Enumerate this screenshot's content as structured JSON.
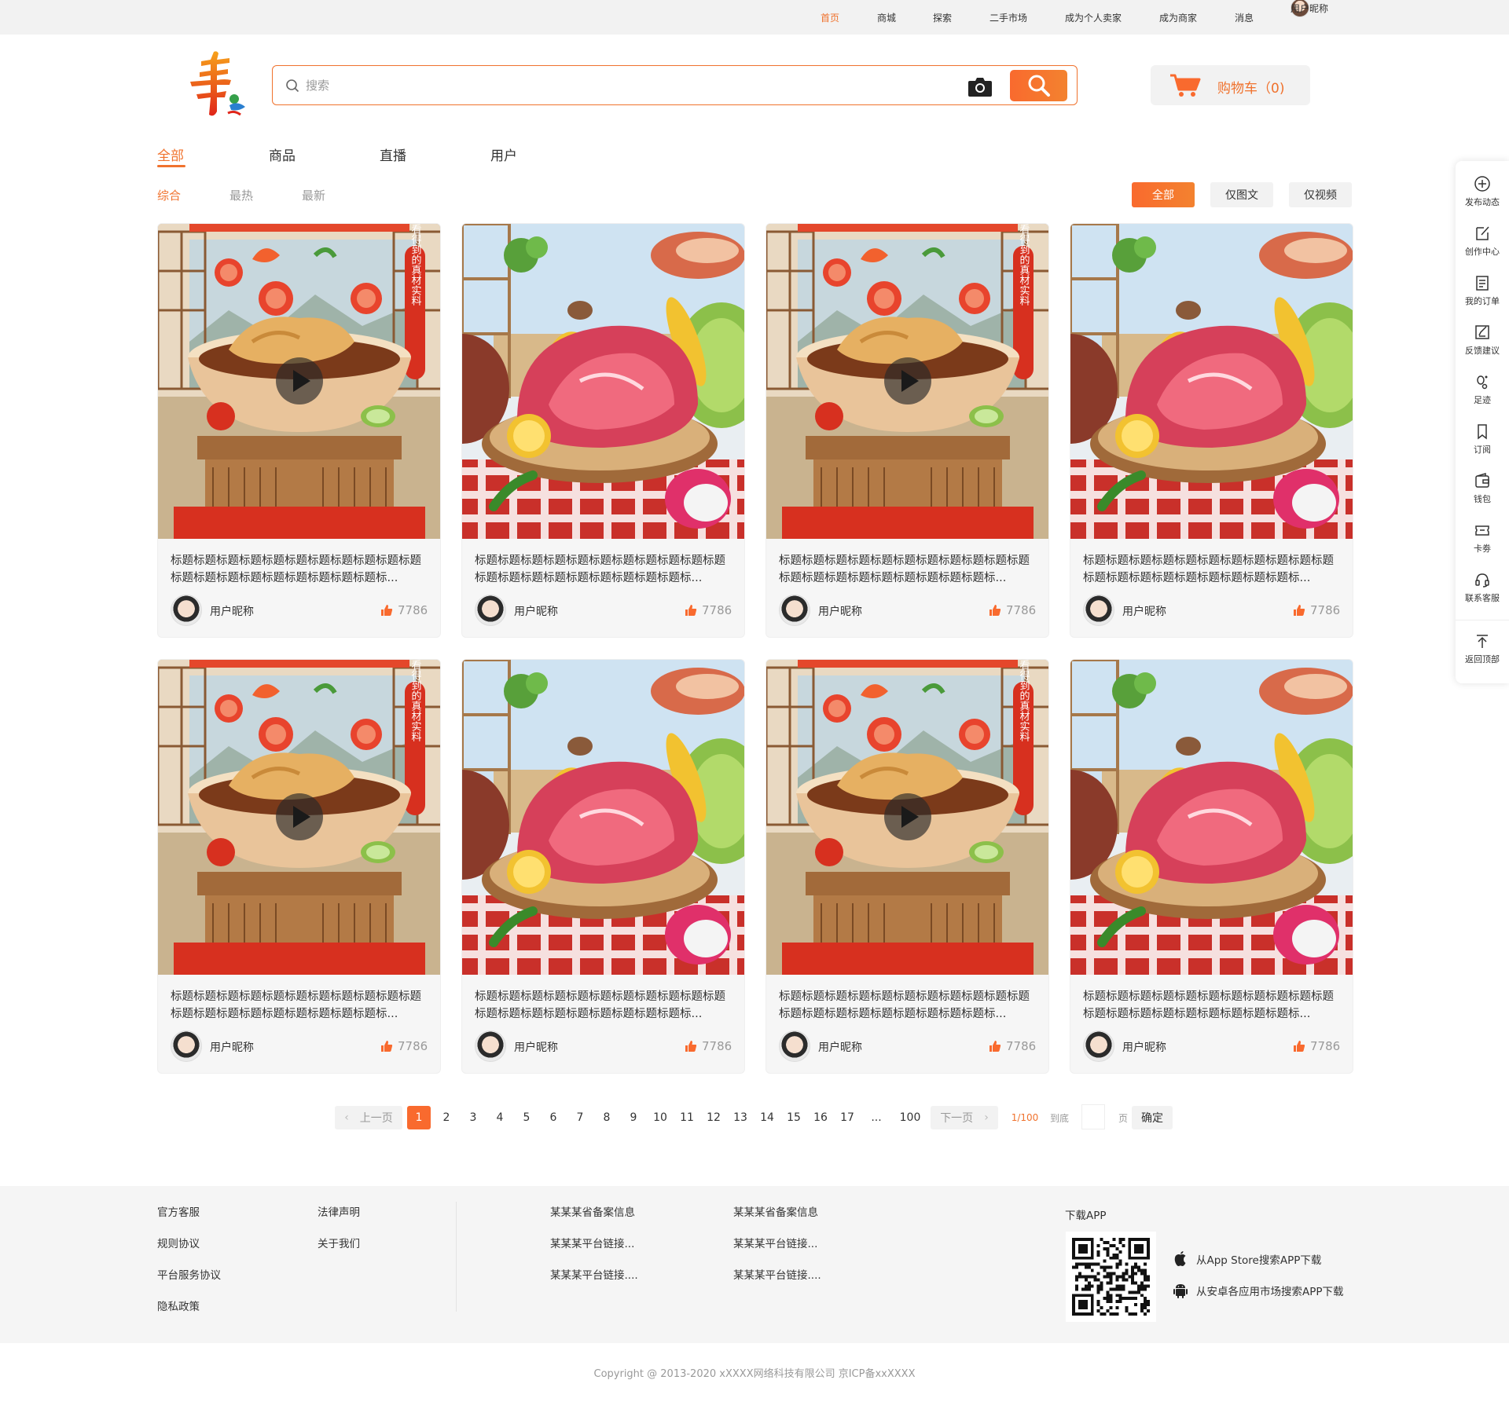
{
  "topnav": {
    "items": [
      "首页",
      "商城",
      "探索",
      "二手市场",
      "成为个人卖家",
      "成为商家",
      "消息"
    ],
    "user_name": "用户昵称"
  },
  "search": {
    "placeholder": "搜索"
  },
  "cart": {
    "label": "购物车（0)"
  },
  "main_tabs": [
    "全部",
    "商品",
    "直播",
    "用户"
  ],
  "sub_tabs": [
    "综合",
    "最热",
    "最新"
  ],
  "filters": [
    "全部",
    "仅图文",
    "仅视频"
  ],
  "cards": [
    {
      "title": "标题标题标题标题标题标题标题标题标题标题标题标题标题标题标题标题标题标题标题标题标...",
      "user": "用户昵称",
      "likes": "7786",
      "image": "video-soup-dish-icon"
    },
    {
      "title": "标题标题标题标题标题标题标题标题标题标题标题标题标题标题标题标题标题标题标题标题标...",
      "user": "用户昵称",
      "likes": "7786",
      "image": "raw-meat-icon"
    },
    {
      "title": "标题标题标题标题标题标题标题标题标题标题标题标题标题标题标题标题标题标题标题标题标...",
      "user": "用户昵称",
      "likes": "7786",
      "image": "video-soup-dish-icon"
    },
    {
      "title": "标题标题标题标题标题标题标题标题标题标题标题标题标题标题标题标题标题标题标题标题标...",
      "user": "用户昵称",
      "likes": "7786",
      "image": "raw-meat-icon"
    },
    {
      "title": "标题标题标题标题标题标题标题标题标题标题标题标题标题标题标题标题标题标题标题标题标...",
      "user": "用户昵称",
      "likes": "7786",
      "image": "video-soup-dish-icon"
    },
    {
      "title": "标题标题标题标题标题标题标题标题标题标题标题标题标题标题标题标题标题标题标题标题标...",
      "user": "用户昵称",
      "likes": "7786",
      "image": "raw-meat-icon"
    },
    {
      "title": "标题标题标题标题标题标题标题标题标题标题标题标题标题标题标题标题标题标题标题标题标...",
      "user": "用户昵称",
      "likes": "7786",
      "image": "video-soup-dish-icon"
    },
    {
      "title": "标题标题标题标题标题标题标题标题标题标题标题标题标题标题标题标题标题标题标题标题标...",
      "user": "用户昵称",
      "likes": "7786",
      "image": "raw-meat-icon"
    }
  ],
  "banner_text": "看得到的真材实料",
  "pagination": {
    "prev": "上一页",
    "pages": [
      "1",
      "2",
      "3",
      "4",
      "5",
      "6",
      "7",
      "8",
      "9",
      "10",
      "11",
      "12",
      "13",
      "14",
      "15",
      "16",
      "17"
    ],
    "ellipsis": "...",
    "last": "100",
    "next": "下一页",
    "current_label": "1/100",
    "goto_label": "到底",
    "page_unit": "页",
    "confirm": "确定"
  },
  "footer": {
    "col1": [
      "官方客服",
      "规则协议",
      "平台服务协议",
      "隐私政策"
    ],
    "col2": [
      "法律声明",
      "关于我们"
    ],
    "col3": [
      "某某某省备案信息",
      "某某某平台链接...",
      "某某某平台链接...."
    ],
    "col4": [
      "某某某省备案信息",
      "某某某平台链接...",
      "某某某平台链接...."
    ],
    "download_title": "下载APP",
    "app_store": "从App Store搜索APP下载",
    "android": "从安卓各应用市场搜索APP下载",
    "copyright": "Copyright @ 2013-2020 xXXXX网络科技有限公司 京ICP备xxXXXX"
  },
  "sidebar": [
    "发布动态",
    "创作中心",
    "我的订单",
    "反馈建议",
    "足迹",
    "订阅",
    "钱包",
    "卡劵",
    "联系客服",
    "返回顶部"
  ],
  "colors": {
    "accent": "#f0722d",
    "gray_bg": "#f2f2f2"
  }
}
